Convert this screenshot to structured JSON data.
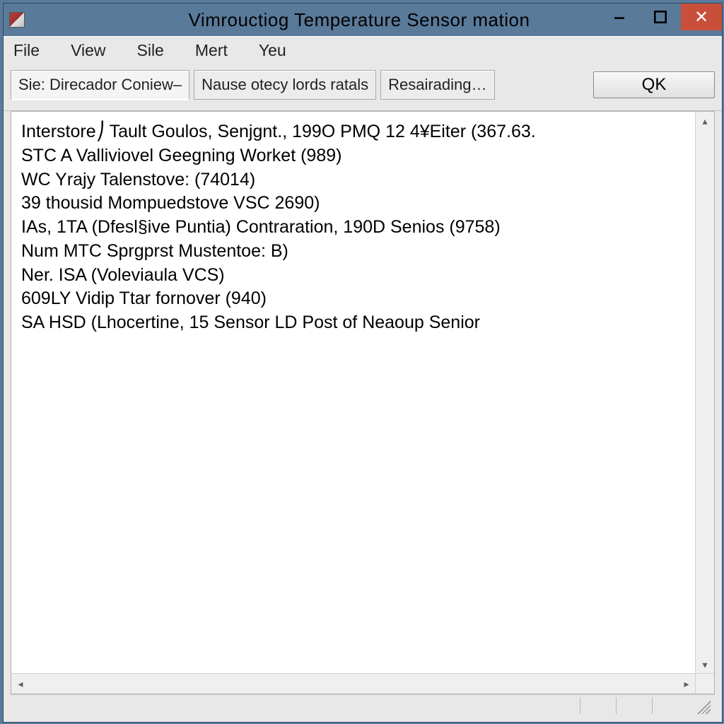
{
  "window": {
    "title": "Vimrouctiog Temperature Sensor mation"
  },
  "menu": {
    "items": [
      "File",
      "View",
      "Sile",
      "Mert",
      "Yeu"
    ]
  },
  "toolbar": {
    "tabs": [
      "Sie: Direcador Coniew–",
      "Nause otecy lords ratals",
      "Resairading…"
    ],
    "qk_label": "QK"
  },
  "content": {
    "lines": [
      "Interstore⎠ Tault Goulos, Senjgnt., 199O PMQ 12 4¥Eiter (367.63.",
      "STC A Valliviovel Geegning Worket (989)",
      "WC Yrajy Talenstove: (74014)",
      "39 thousid Mompuedstove VSC 2690)",
      "IAs, 1TA (Dfesl§ive Puntia) Contraration, 190D Senios (9758)",
      "Num MTC Sprgprst Mustentoe: B)",
      "Ner. ISA (Voleviaula VCS)",
      "609LY Vidip Ttar fornover (940)",
      "SA HSD (Lhocertine, 15 Sensor LD Post of Neaoup Senior"
    ]
  }
}
